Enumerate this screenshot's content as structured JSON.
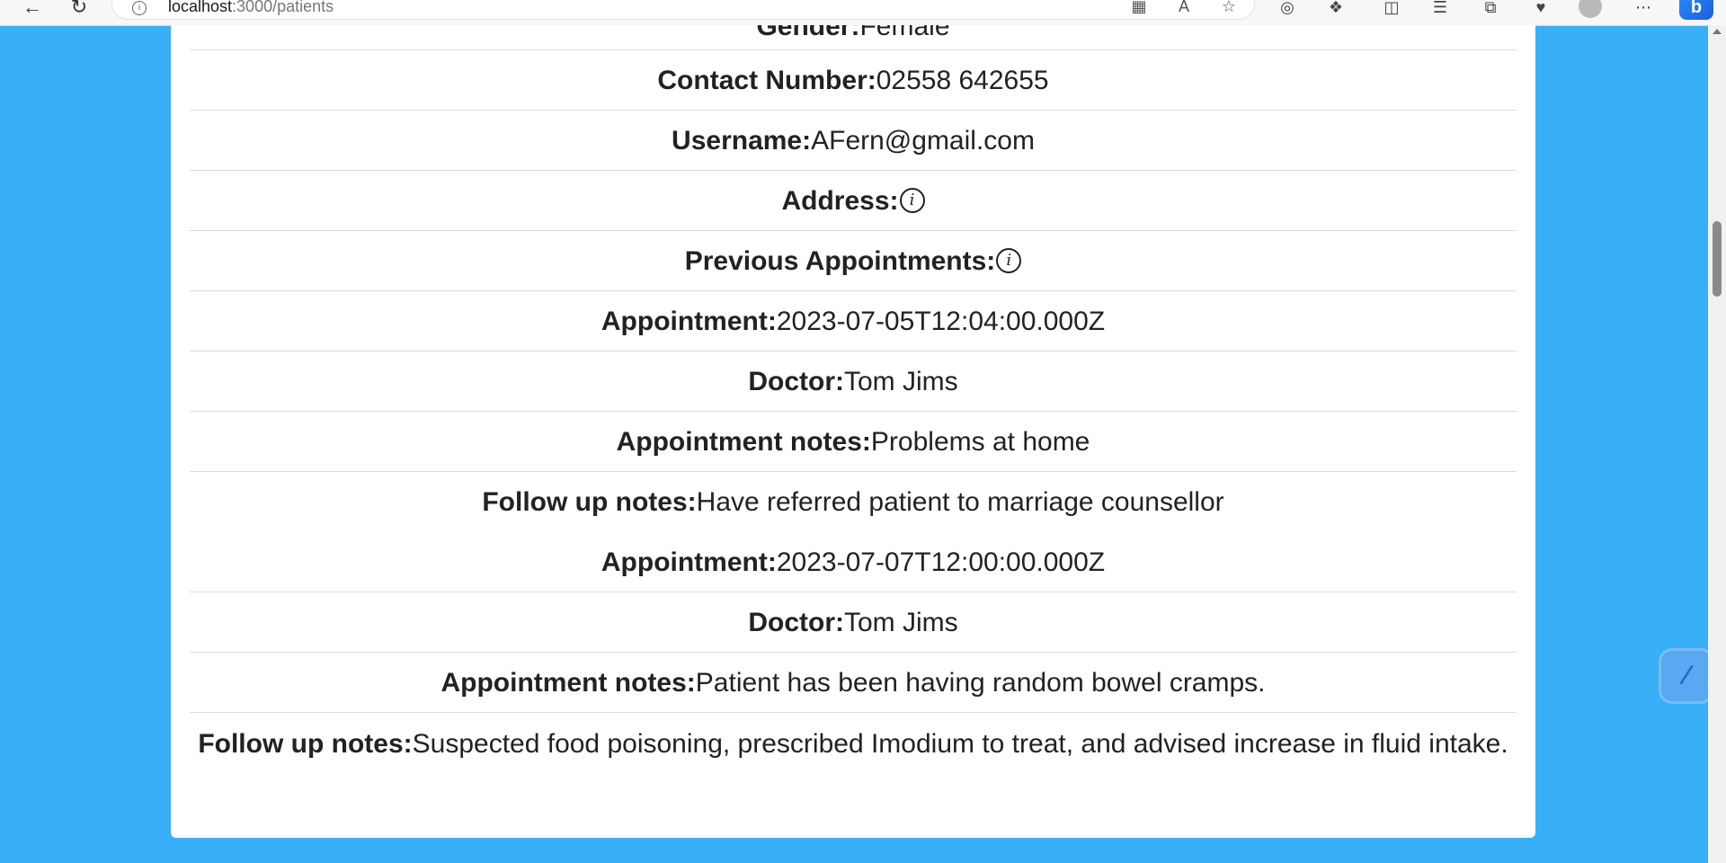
{
  "browser": {
    "url_host": "localhost",
    "url_path": ":3000/patients"
  },
  "patient": {
    "gender_label": "Gender:",
    "gender_value": "Female",
    "contact_label": "Contact Number:",
    "contact_value": "02558 642655",
    "username_label": "Username:",
    "username_value": "AFern@gmail.com",
    "address_label": "Address:",
    "previous_label": "Previous Appointments:"
  },
  "appointments": [
    {
      "appointment_label": "Appointment:",
      "appointment_value": "2023-07-05T12:04:00.000Z",
      "doctor_label": "Doctor:",
      "doctor_value": "Tom Jims",
      "notes_label": "Appointment notes:",
      "notes_value": "Problems at home",
      "followup_label": "Follow up notes:",
      "followup_value": "Have referred patient to marriage counsellor"
    },
    {
      "appointment_label": "Appointment:",
      "appointment_value": "2023-07-07T12:00:00.000Z",
      "doctor_label": "Doctor:",
      "doctor_value": "Tom Jims",
      "notes_label": "Appointment notes:",
      "notes_value": "Patient has been having random bowel cramps.",
      "followup_label": "Follow up notes:",
      "followup_value": "Suspected food poisoning, prescribed Imodium to treat, and advised increase in fluid intake."
    }
  ],
  "icons": {
    "info_glyph": "i"
  }
}
